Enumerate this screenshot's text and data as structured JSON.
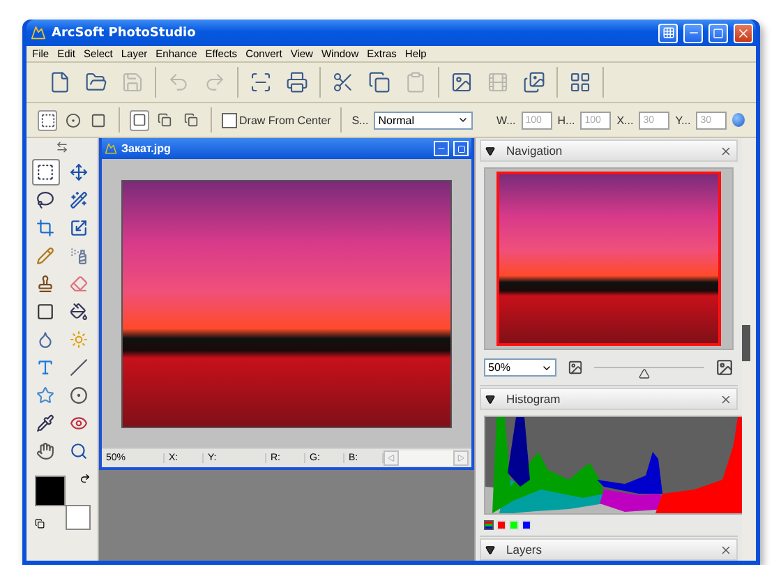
{
  "window": {
    "title": "ArcSoft PhotoStudio"
  },
  "menu": [
    "File",
    "Edit",
    "Select",
    "Layer",
    "Enhance",
    "Effects",
    "Convert",
    "View",
    "Window",
    "Extras",
    "Help"
  ],
  "toolbar": [
    [
      {
        "kind": "new",
        "disabled": false
      },
      {
        "kind": "open",
        "disabled": false
      },
      {
        "kind": "save",
        "disabled": true
      }
    ],
    [
      {
        "kind": "undo",
        "disabled": true
      },
      {
        "kind": "redo",
        "disabled": true
      }
    ],
    [
      {
        "kind": "scan",
        "disabled": false
      },
      {
        "kind": "print",
        "disabled": false
      }
    ],
    [
      {
        "kind": "cut",
        "disabled": false
      },
      {
        "kind": "copy",
        "disabled": false
      },
      {
        "kind": "paste",
        "disabled": true
      }
    ],
    [
      {
        "kind": "photo",
        "disabled": false
      },
      {
        "kind": "film",
        "disabled": true
      },
      {
        "kind": "batch",
        "disabled": false
      }
    ],
    [
      {
        "kind": "album",
        "disabled": false
      }
    ]
  ],
  "options_bar": {
    "shapes": [
      {
        "kind": "rect",
        "selected": true
      },
      {
        "kind": "ellipse",
        "selected": false
      },
      {
        "kind": "rounded",
        "selected": false
      }
    ],
    "modes": [
      {
        "kind": "new",
        "selected": true
      },
      {
        "kind": "add",
        "selected": false
      },
      {
        "kind": "subtract",
        "selected": false
      }
    ],
    "draw_from_center": {
      "label": "Draw From Center",
      "checked": false
    },
    "style_label": "S...",
    "style_value": "Normal",
    "fields": [
      {
        "label": "W...",
        "value": "100",
        "disabled": true
      },
      {
        "label": "H...",
        "value": "100",
        "disabled": true
      },
      {
        "label": "X...",
        "value": "30",
        "disabled": true
      },
      {
        "label": "Y...",
        "value": "30",
        "disabled": true
      }
    ]
  },
  "tools": [
    {
      "kind": "marquee",
      "selected": true
    },
    {
      "kind": "move",
      "selected": false
    },
    {
      "kind": "lasso",
      "selected": false
    },
    {
      "kind": "wand",
      "selected": false
    },
    {
      "kind": "crop",
      "selected": false
    },
    {
      "kind": "transform",
      "selected": false
    },
    {
      "kind": "pencil",
      "selected": false
    },
    {
      "kind": "spray",
      "selected": false
    },
    {
      "kind": "stamp",
      "selected": false
    },
    {
      "kind": "eraser",
      "selected": false
    },
    {
      "kind": "gradient",
      "selected": false
    },
    {
      "kind": "bucket",
      "selected": false
    },
    {
      "kind": "drop",
      "selected": false
    },
    {
      "kind": "sun",
      "selected": false
    },
    {
      "kind": "text",
      "selected": false
    },
    {
      "kind": "line",
      "selected": false
    },
    {
      "kind": "shape",
      "selected": false
    },
    {
      "kind": "vignette",
      "selected": false
    },
    {
      "kind": "picker",
      "selected": false
    },
    {
      "kind": "redeye",
      "selected": false
    },
    {
      "kind": "hand",
      "selected": false
    },
    {
      "kind": "zoom",
      "selected": false
    }
  ],
  "document": {
    "title": "Закат.jpg",
    "zoom": "50%",
    "readouts": [
      "X:",
      "Y:",
      "R:",
      "G:",
      "B:"
    ]
  },
  "navigation": {
    "title": "Navigation",
    "zoom": "50%",
    "level": 0.45
  },
  "histogram": {
    "title": "Histogram",
    "channels": [
      {
        "kind": "all",
        "selected": true
      },
      {
        "kind": "single",
        "color": "#ff0000",
        "selected": false
      },
      {
        "kind": "single",
        "color": "#00ff00",
        "selected": false
      },
      {
        "kind": "single",
        "color": "#0000ff",
        "selected": false
      }
    ]
  },
  "layers": {
    "title": "Layers"
  }
}
